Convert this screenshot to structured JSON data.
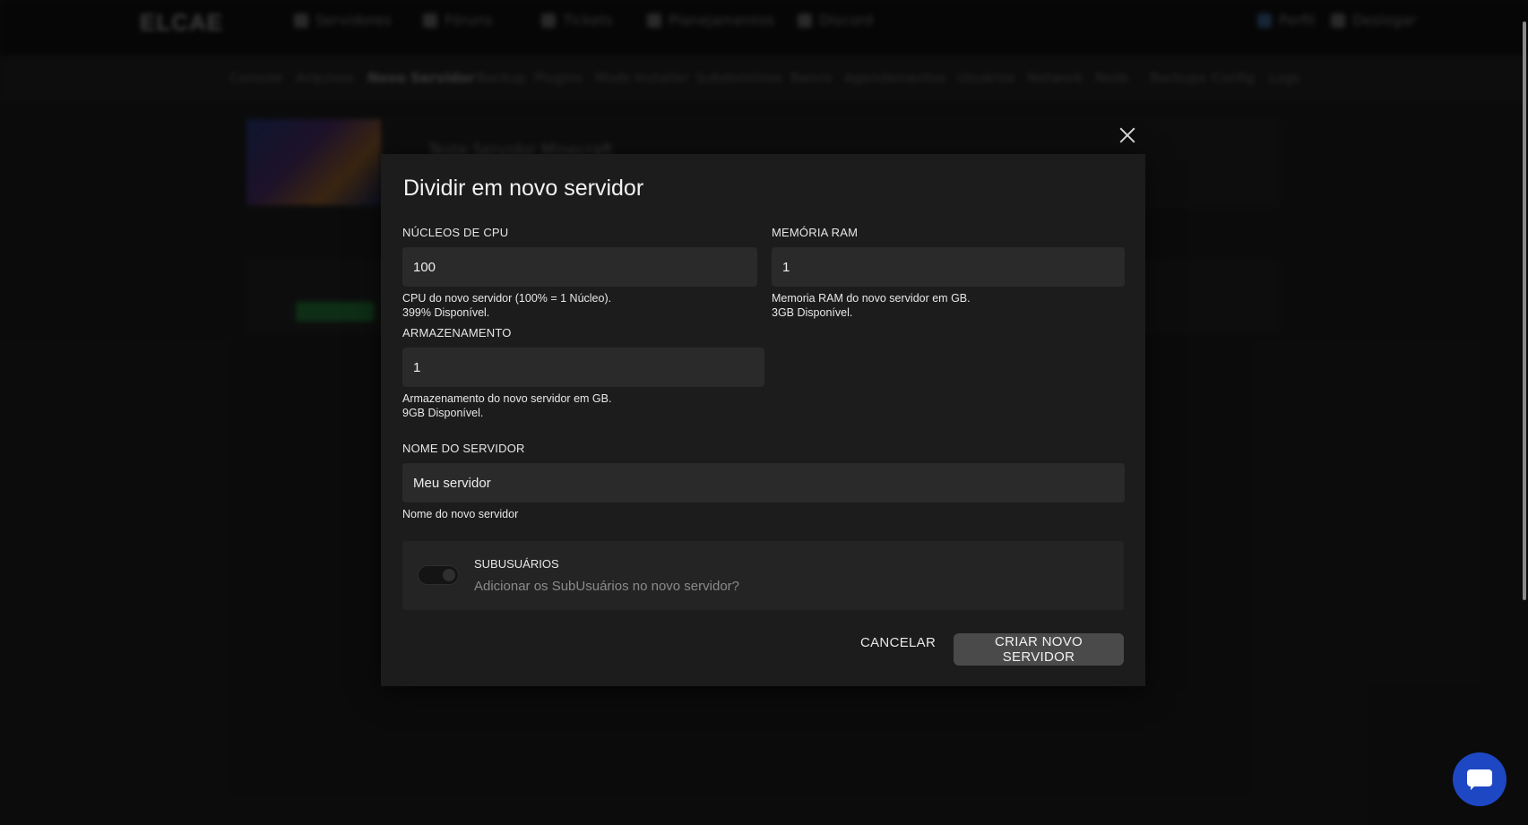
{
  "background": {
    "logo": "ELCAE",
    "top_nav": [
      "Servidores",
      "Fóruns",
      "Tickets",
      "Planejamentos",
      "Discord"
    ],
    "top_right": [
      "Perfil",
      "Deslogar"
    ],
    "sub_nav": [
      "Console",
      "Arquivos",
      "Novo Servidor",
      "Backup",
      "Plugins",
      "Mods Installer",
      "Subdomínios",
      "Banco",
      "Agendamentos",
      "Usuários",
      "Network",
      "Rede",
      "Backups",
      "Config",
      "Logs"
    ],
    "server_title": "Teste Servidor Minecraft"
  },
  "modal": {
    "title": "Dividir em novo servidor",
    "cpu": {
      "label": "Núcleos de CPU",
      "value": "100",
      "help_1": "CPU do novo servidor (100% = 1 Núcleo).",
      "help_2": "399% Disponível."
    },
    "ram": {
      "label": "Memória RAM",
      "value": "1",
      "help_1": "Memoria RAM do novo servidor em GB.",
      "help_2": "3GB Disponível."
    },
    "storage": {
      "label": "Armazenamento",
      "value": "1",
      "help_1": "Armazenamento do novo servidor em GB.",
      "help_2": "9GB Disponível."
    },
    "name": {
      "label": "Nome do servidor",
      "value": "Meu servidor",
      "help": "Nome do novo servidor"
    },
    "subusers": {
      "title": "SubUsuários",
      "description": "Adicionar os SubUsuários no novo servidor?",
      "enabled": false
    },
    "cancel_label": "CANCELAR",
    "create_label": "CRIAR NOVO SERVIDOR"
  },
  "colors": {
    "page_bg": "#151515",
    "modal_bg": "#1c1c1c",
    "input_bg": "#2a2a2a",
    "primary_button": "#4a4a4a",
    "chat_button": "#1e47c4"
  }
}
